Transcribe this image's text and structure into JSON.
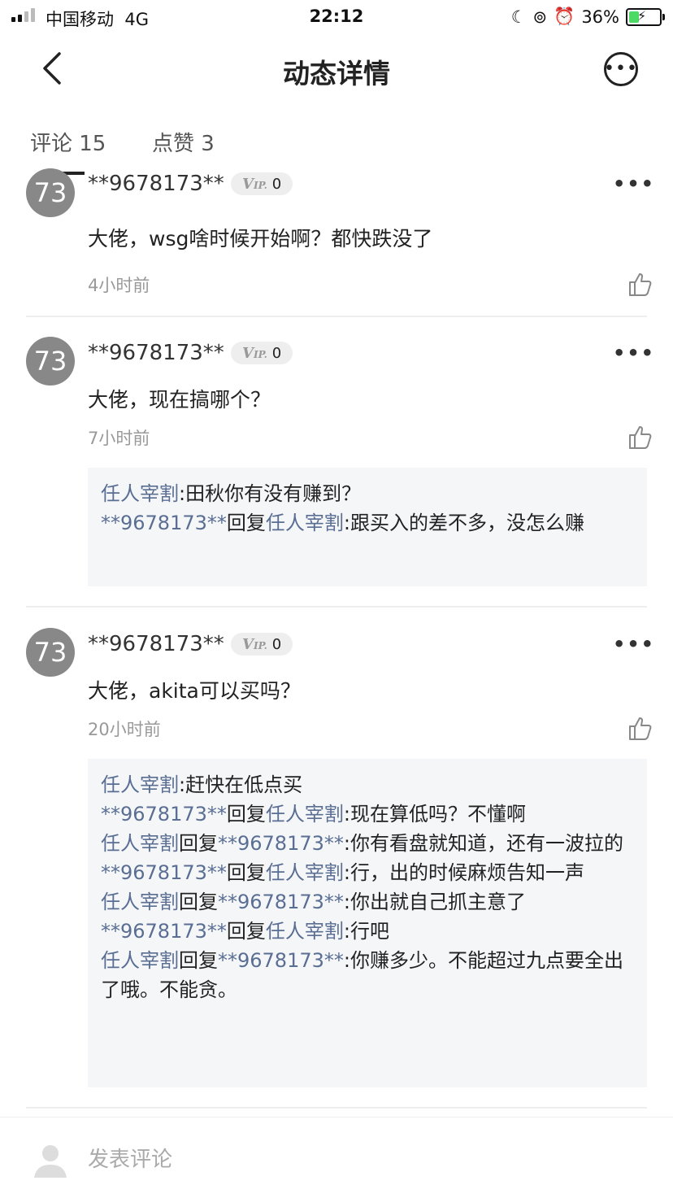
{
  "status_bar": {
    "carrier": "中国移动",
    "network": "4G",
    "time": "22:12",
    "battery": "36%",
    "battery_level": 0.36
  },
  "nav": {
    "title": "动态详情"
  },
  "tabs": [
    {
      "label": "评论 15"
    },
    {
      "label": "点赞 3"
    }
  ],
  "comments": [
    {
      "avatar": "73",
      "user": "**9678173**",
      "vip_level": "0",
      "text": "大佬，wsg啥时候开始啊？都快跌没了",
      "time": "4小时前",
      "replies": []
    },
    {
      "avatar": "73",
      "user": "**9678173**",
      "vip_level": "0",
      "text": "大佬，现在搞哪个？",
      "time": "7小时前",
      "replies": [
        {
          "from": "任人宰割",
          "connector": "",
          "to": "",
          "text": ":田秋你有没有赚到？"
        },
        {
          "from": "**9678173**",
          "connector": "回复",
          "to": "任人宰割",
          "text": ":跟买入的差不多，没怎么赚"
        }
      ]
    },
    {
      "avatar": "73",
      "user": "**9678173**",
      "vip_level": "0",
      "text": "大佬，akita可以买吗？",
      "time": "20小时前",
      "replies": [
        {
          "from": "任人宰割",
          "connector": "",
          "to": "",
          "text": ":赶快在低点买"
        },
        {
          "from": "**9678173**",
          "connector": "回复",
          "to": "任人宰割",
          "text": ":现在算低吗？不懂啊"
        },
        {
          "from": "任人宰割",
          "connector": "回复",
          "to": "**9678173**",
          "text": ":你有看盘就知道，还有一波拉的"
        },
        {
          "from": "**9678173**",
          "connector": "回复",
          "to": "任人宰割",
          "text": ":行，出的时候麻烦告知一声"
        },
        {
          "from": "任人宰割",
          "connector": "回复",
          "to": "**9678173**",
          "text": ":你出就自己抓主意了"
        },
        {
          "from": "**9678173**",
          "connector": "回复",
          "to": "任人宰割",
          "text": ":行吧"
        },
        {
          "from": "任人宰割",
          "connector": "回复",
          "to": "**9678173**",
          "text": ":你赚多少。不能超过九点要全出了哦。不能贪。"
        }
      ]
    }
  ],
  "comment_input": {
    "placeholder": "发表评论"
  },
  "icons": {
    "back": "chevron-left-icon",
    "more": "more-circle-icon",
    "like": "thumbs-up-icon",
    "menu": "more-dots-icon"
  }
}
